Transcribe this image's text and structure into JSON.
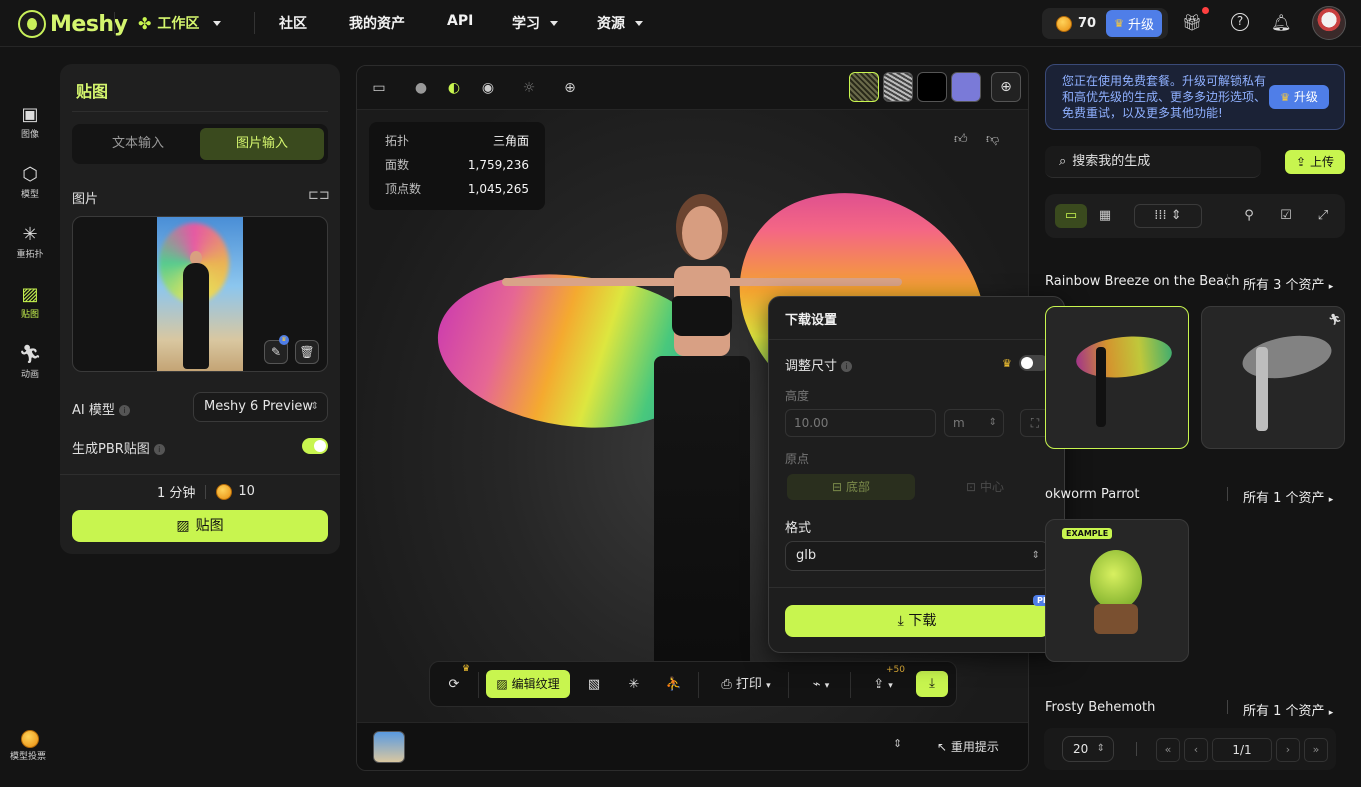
{
  "brand": {
    "name": "Meshy",
    "accent": "#c8f54f",
    "pro_color": "#4f7ee8"
  },
  "nav": {
    "workspace": "工作区",
    "community": "社区",
    "assets": "我的资产",
    "api": "API",
    "learn": "学习",
    "resources": "资源"
  },
  "account": {
    "credits": "70",
    "upgrade": "升级"
  },
  "sidebar": {
    "items": [
      {
        "label": "图像",
        "icon": "image-ai-icon"
      },
      {
        "label": "模型",
        "icon": "cube-icon"
      },
      {
        "label": "重拓扑",
        "icon": "retopo-icon"
      },
      {
        "label": "贴图",
        "icon": "texture-icon"
      },
      {
        "label": "动画",
        "icon": "running-icon"
      }
    ],
    "bottom_label": "模型投票"
  },
  "texture_panel": {
    "title": "贴图",
    "tab_text": "文本输入",
    "tab_image": "图片输入",
    "image_label": "图片",
    "ai_model_label": "AI 模型",
    "ai_model_value": "Meshy 6 Preview",
    "pbr_label": "生成PBR贴图",
    "pbr_on": true,
    "time": "1 分钟",
    "cost": "10",
    "generate": "贴图"
  },
  "stats": {
    "rows": [
      {
        "k": "拓扑",
        "v": "三角面"
      },
      {
        "k": "面数",
        "v": "1,759,236"
      },
      {
        "k": "顶点数",
        "v": "1,045,265"
      }
    ]
  },
  "viewport_tools": {
    "edit_texture": "编辑纹理",
    "print": "打印",
    "bonus": "+50",
    "reuse_prompt": "重用提示"
  },
  "download_popup": {
    "title": "下载设置",
    "resize_label": "调整尺寸",
    "resize_on": false,
    "height_label": "高度",
    "height_value": "10.00",
    "unit": "m",
    "origin_label": "原点",
    "origin_bottom": "底部",
    "origin_center": "中心",
    "format_label": "格式",
    "format_value": "glb",
    "download": "下载",
    "pro": "PRO"
  },
  "right_panel": {
    "notice": "您正在使用免费套餐。升级可解锁私有和高优先级的生成、更多多边形选项、免费重试，以及更多其他功能!",
    "notice_button": "升级",
    "search_placeholder": "搜索我的生成",
    "upload": "上传",
    "groups": [
      {
        "title": "Rainbow Breeze on the Beach",
        "count": "所有 3 个资产"
      },
      {
        "title": "okworm Parrot",
        "count": "所有 1 个资产",
        "badge": "EXAMPLE"
      },
      {
        "title": "Frosty Behemoth",
        "count": "所有 1 个资产"
      }
    ],
    "page_size": "20",
    "page": "1/1"
  }
}
